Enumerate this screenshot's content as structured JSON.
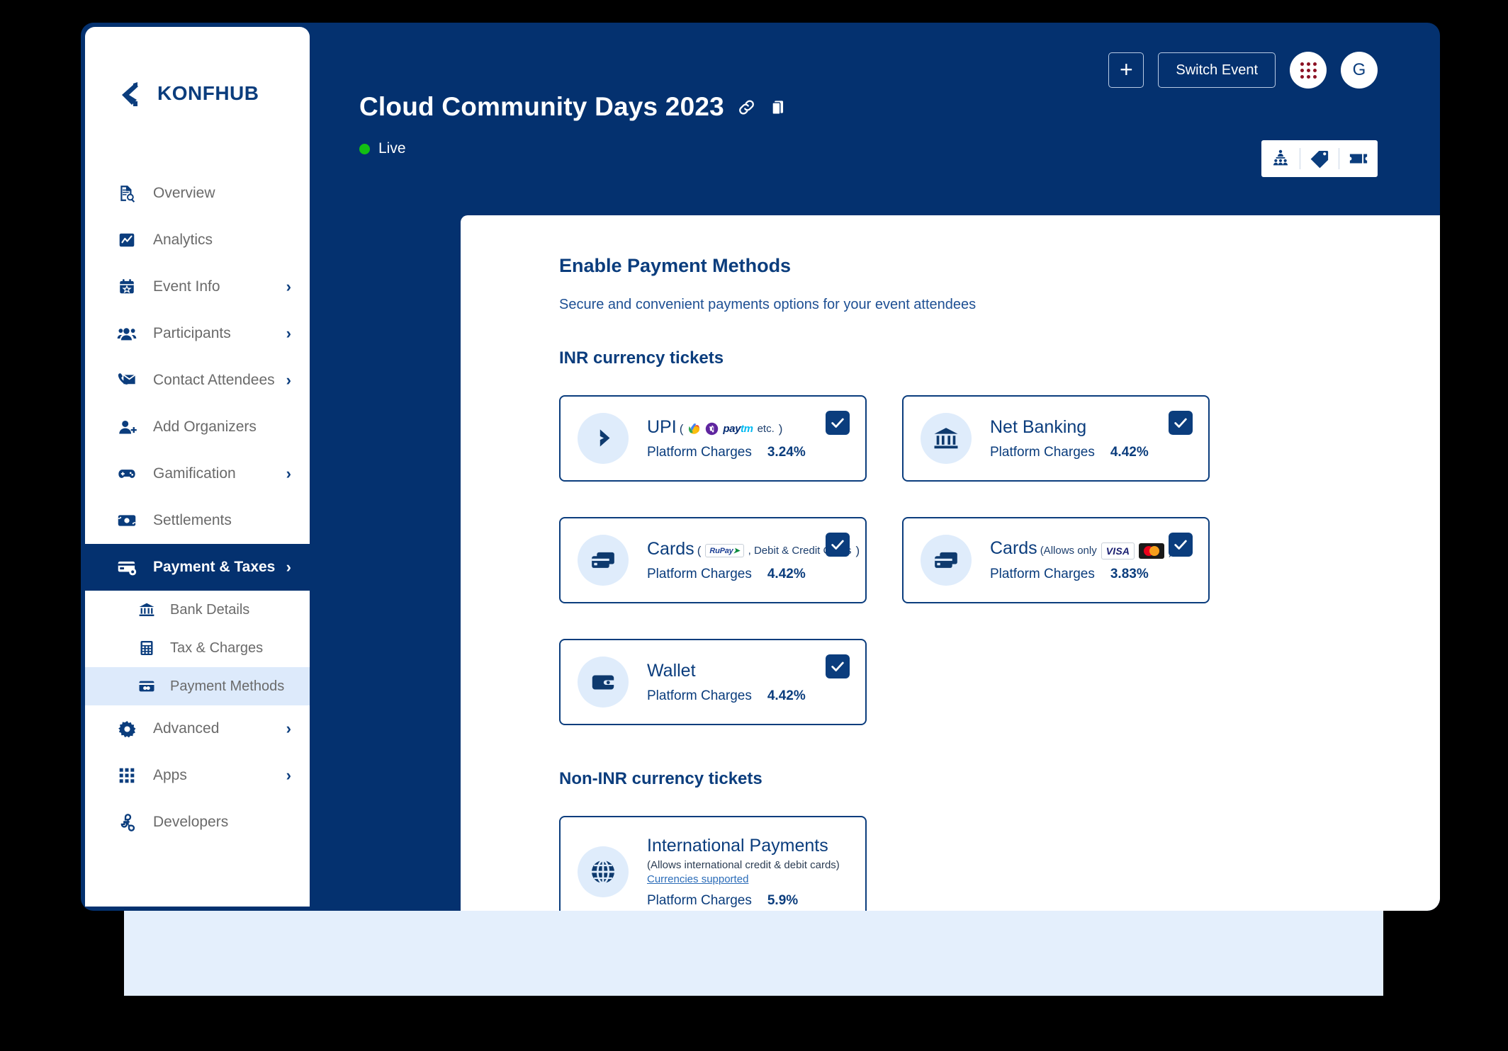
{
  "brand": {
    "logo_text": "KONFHUB",
    "primary_color": "#04316f",
    "accent_color": "#0b3d7d"
  },
  "topbar": {
    "add_label": "+",
    "switch_event_label": "Switch Event",
    "apps_icon": "grid-dots-icon",
    "avatar_initial": "G",
    "quick_icons": [
      "auditorium-icon",
      "tag-icon",
      "ticket-icon"
    ]
  },
  "event": {
    "title": "Cloud Community Days 2023",
    "link_icon": "link-icon",
    "copy_icon": "copy-icon",
    "status_label": "Live",
    "status_color": "#13c013"
  },
  "sidebar": {
    "items": [
      {
        "label": "Overview",
        "icon": "document-search-icon",
        "chevron": ""
      },
      {
        "label": "Analytics",
        "icon": "chart-icon",
        "chevron": ""
      },
      {
        "label": "Event Info",
        "icon": "calendar-star-icon",
        "chevron": "›"
      },
      {
        "label": "Participants",
        "icon": "people-icon",
        "chevron": "›"
      },
      {
        "label": "Contact Attendees",
        "icon": "mail-phone-icon",
        "chevron": "›"
      },
      {
        "label": "Add Organizers",
        "icon": "person-add-icon",
        "chevron": ""
      },
      {
        "label": "Gamification",
        "icon": "gamepad-icon",
        "chevron": "›"
      },
      {
        "label": "Settlements",
        "icon": "banknote-icon",
        "chevron": ""
      },
      {
        "label": "Payment & Taxes",
        "icon": "card-gear-icon",
        "chevron": "›",
        "active": true
      },
      {
        "label": "Advanced",
        "icon": "gear-icon",
        "chevron": "›"
      },
      {
        "label": "Apps",
        "icon": "apps-grid-icon",
        "chevron": "›"
      },
      {
        "label": "Developers",
        "icon": "developers-icon",
        "chevron": ""
      }
    ],
    "subitems": [
      {
        "label": "Bank Details",
        "icon": "bank-icon"
      },
      {
        "label": "Tax & Charges",
        "icon": "calculator-icon"
      },
      {
        "label": "Payment Methods",
        "icon": "payment-card-icon",
        "selected": true
      }
    ]
  },
  "main": {
    "heading": "Enable Payment Methods",
    "subheading": "Secure and convenient payments options for your event attendees",
    "sections": [
      {
        "title": "INR currency tickets",
        "cards": [
          {
            "name": "UPI",
            "icon": "upi-icon",
            "paren_open": "(",
            "paren_close": ")",
            "logos": [
              "gpay-logo",
              "phonepe-logo",
              "paytm-logo"
            ],
            "note": "etc.",
            "charges_label": "Platform Charges",
            "charges_value": "3.24%",
            "checked": true
          },
          {
            "name": "Net Banking",
            "icon": "bank-icon",
            "charges_label": "Platform Charges",
            "charges_value": "4.42%",
            "checked": true
          },
          {
            "name": "Cards",
            "icon": "cards-icon",
            "paren_open": "(",
            "paren_close": ")",
            "logos": [
              "rupay-logo"
            ],
            "note": ", Debit & Credit Cards",
            "charges_label": "Platform Charges",
            "charges_value": "4.42%",
            "checked": true
          },
          {
            "name": "Cards",
            "icon": "cards-icon",
            "prefix_note": "(Allows only",
            "logos": [
              "visa-logo",
              "mastercard-logo"
            ],
            "paren_close": ")",
            "charges_label": "Platform Charges",
            "charges_value": "3.83%",
            "checked": true
          },
          {
            "name": "Wallet",
            "icon": "wallet-icon",
            "charges_label": "Platform Charges",
            "charges_value": "4.42%",
            "checked": true
          }
        ]
      },
      {
        "title": "Non-INR currency tickets",
        "cards": [
          {
            "name": "International Payments",
            "icon": "globe-icon",
            "sub": "(Allows international credit & debit cards)",
            "link": "Currencies supported",
            "charges_label": "Platform Charges",
            "charges_value": "5.9%",
            "checked": false
          }
        ]
      }
    ]
  }
}
